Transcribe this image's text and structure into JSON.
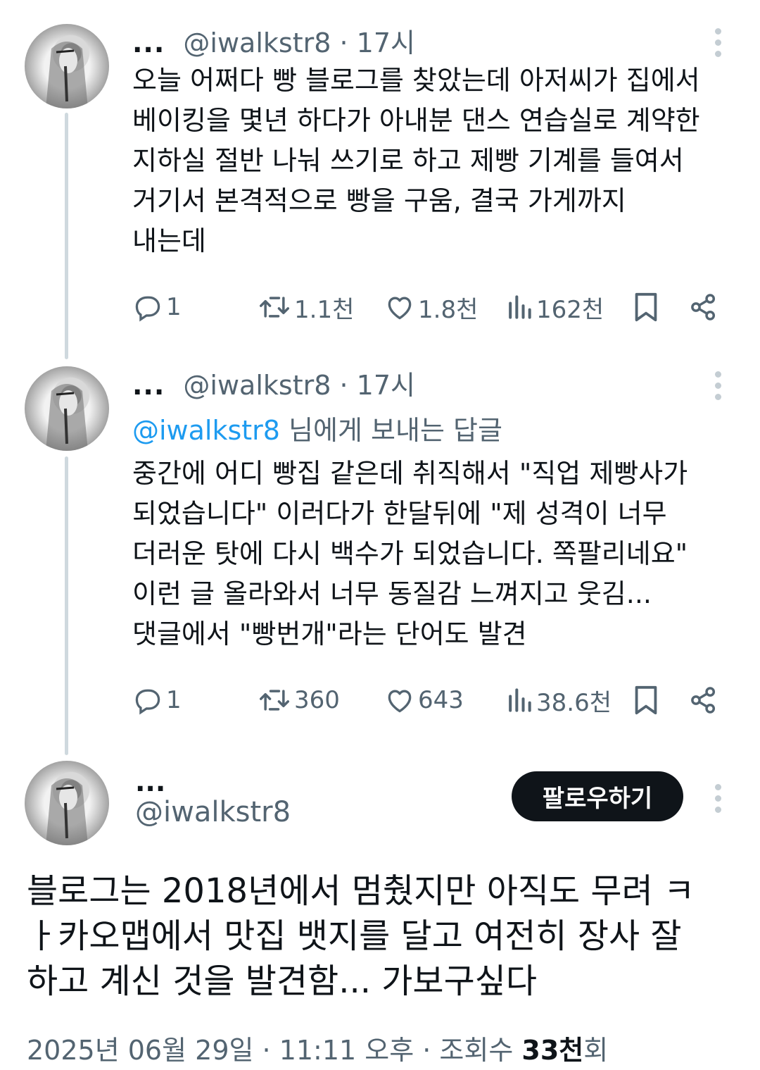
{
  "thread": [
    {
      "display_name": "...",
      "handle": "@iwalkstr8",
      "time": "· 17시",
      "text": "오늘 어쩌다 빵 블로그를 찾았는데 아저씨가 집에서\n베이킹을 몇년 하다가 아내분 댄스 연습실로 계약한\n지하실 절반 나눠 쓰기로 하고 제빵 기계를 들여서\n거기서 본격적으로 빵을 구움, 결국 가게까지\n내는데",
      "replies": "1",
      "retweets": "1.1천",
      "likes": "1.8천",
      "views": "162천"
    },
    {
      "display_name": "...",
      "handle": "@iwalkstr8",
      "time": "· 17시",
      "reply_to_handle": "@iwalkstr8",
      "reply_to_suffix": " 님에게 보내는 답글",
      "text": "중간에 어디 빵집 같은데 취직해서 \"직업 제빵사가\n되었습니다\" 이러다가 한달뒤에 \"제 성격이 너무\n더러운 탓에 다시 백수가 되었습니다. 쪽팔리네요\"\n이런 글 올라와서 너무 동질감 느껴지고 웃김...\n댓글에서 \"빵번개\"라는 단어도 발견",
      "replies": "1",
      "retweets": "360",
      "likes": "643",
      "views": "38.6천"
    }
  ],
  "main_tweet": {
    "display_name": "...",
    "handle": "@iwalkstr8",
    "follow_label": "팔로우하기",
    "text": "블로그는 2018년에서 멈췄지만 아직도 무려 ㅋ\nㅏ카오맵에서 맛집 뱃지를 달고 여전히 장사 잘\n하고 계신 것을 발견함... 가보구싶다",
    "date": "2025년 06월 29일 · 11:11 오후 · 조회수 ",
    "view_count": "33천",
    "view_suffix": "회"
  },
  "colors": {
    "text": "#0f1419",
    "secondary": "#536471",
    "mention": "#1d9bf0",
    "thread_line": "#cfd9de",
    "follow_button": "#0f1419"
  },
  "icons": [
    "reply-icon",
    "retweet-icon",
    "like-icon",
    "views-icon",
    "bookmark-icon",
    "share-icon",
    "more-icon"
  ]
}
